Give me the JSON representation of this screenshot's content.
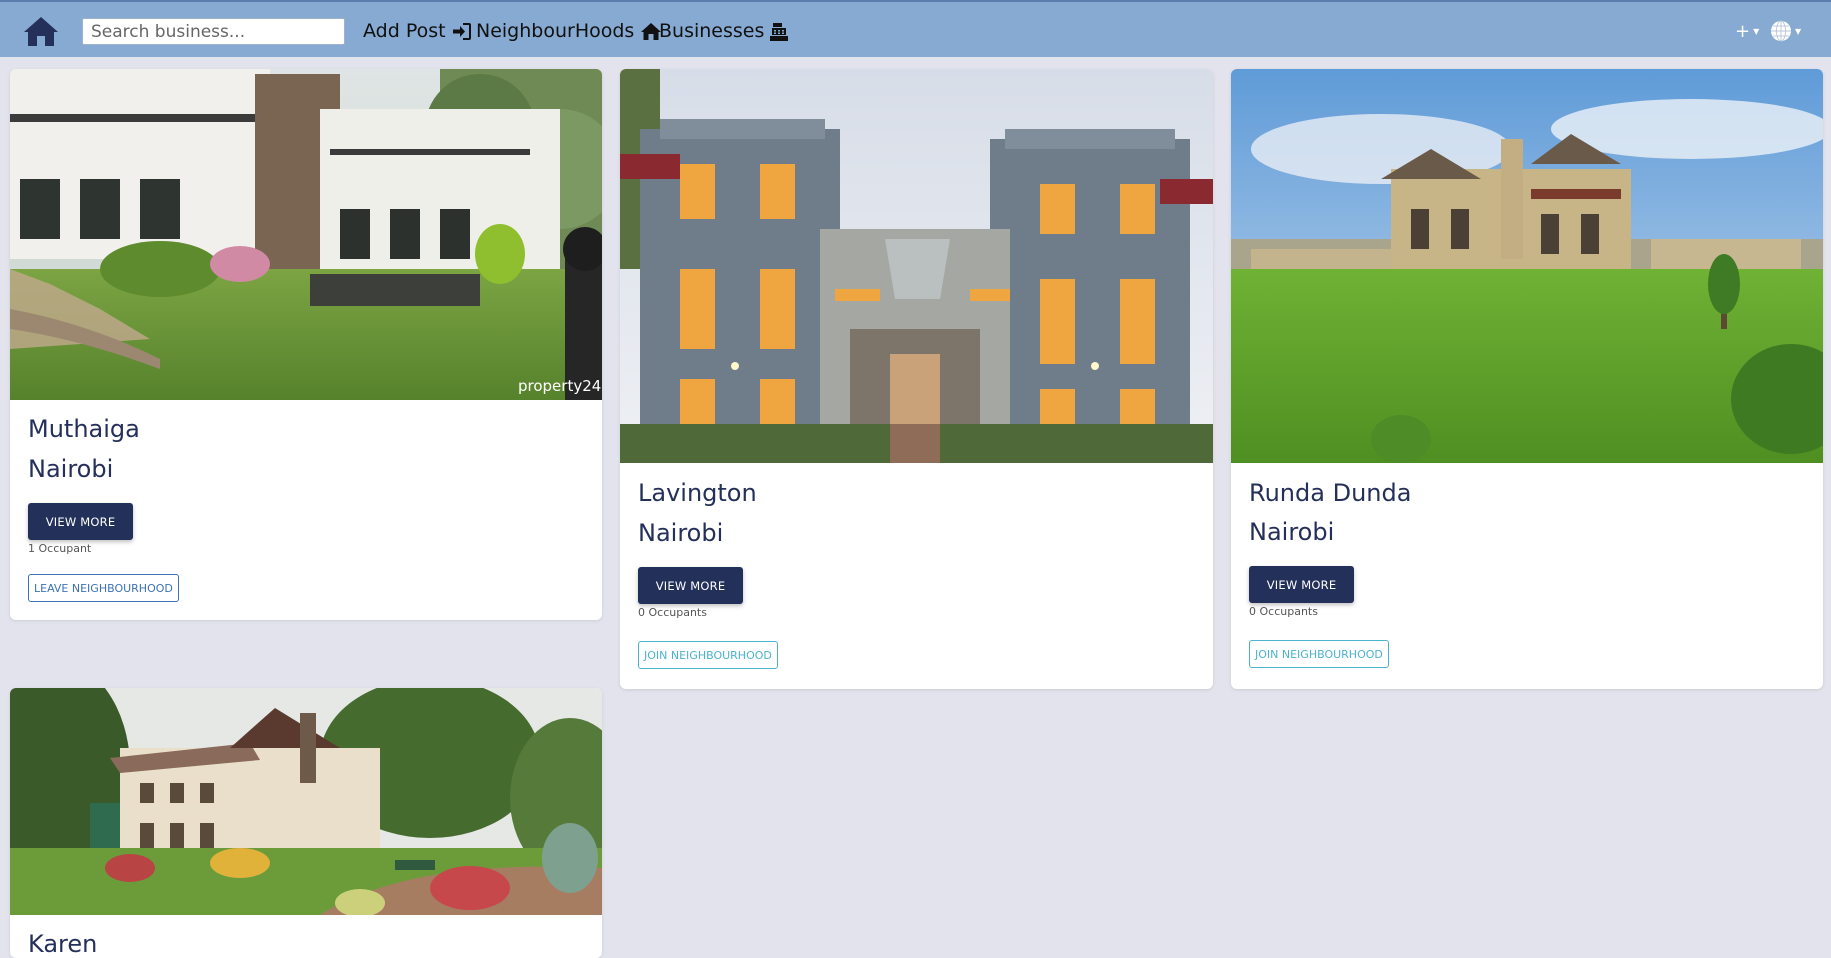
{
  "nav": {
    "search_placeholder": "Search business...",
    "add_post": "Add Post",
    "neighbourhoods": "NeighbourHoods",
    "businesses": "Businesses",
    "plus": "+",
    "icons": {
      "home": "home-icon",
      "add_post": "sign-in-icon",
      "neighbourhoods": "home-icon",
      "businesses": "cash-register-icon",
      "avatar": "globe-icon"
    }
  },
  "colors": {
    "navbar": "#86aad2",
    "background": "#e2e3ec",
    "primary_button": "#23305a",
    "leave_outline": "#3d72b4",
    "join_outline": "#4cb3cf"
  },
  "neighbourhoods": [
    {
      "name": "Muthaiga",
      "city": "Nairobi",
      "view_label": "VIEW MORE",
      "occupants": "1 Occupant",
      "action_label": "LEAVE NEIGHBOURHOOD",
      "image_watermark": "property24"
    },
    {
      "name": "Lavington",
      "city": "Nairobi",
      "view_label": "VIEW MORE",
      "occupants": "0 Occupants",
      "action_label": "JOIN NEIGHBOURHOOD"
    },
    {
      "name": "Runda Dunda",
      "city": "Nairobi",
      "view_label": "VIEW MORE",
      "occupants": "0 Occupants",
      "action_label": "JOIN NEIGHBOURHOOD"
    },
    {
      "name": "Karen"
    }
  ]
}
